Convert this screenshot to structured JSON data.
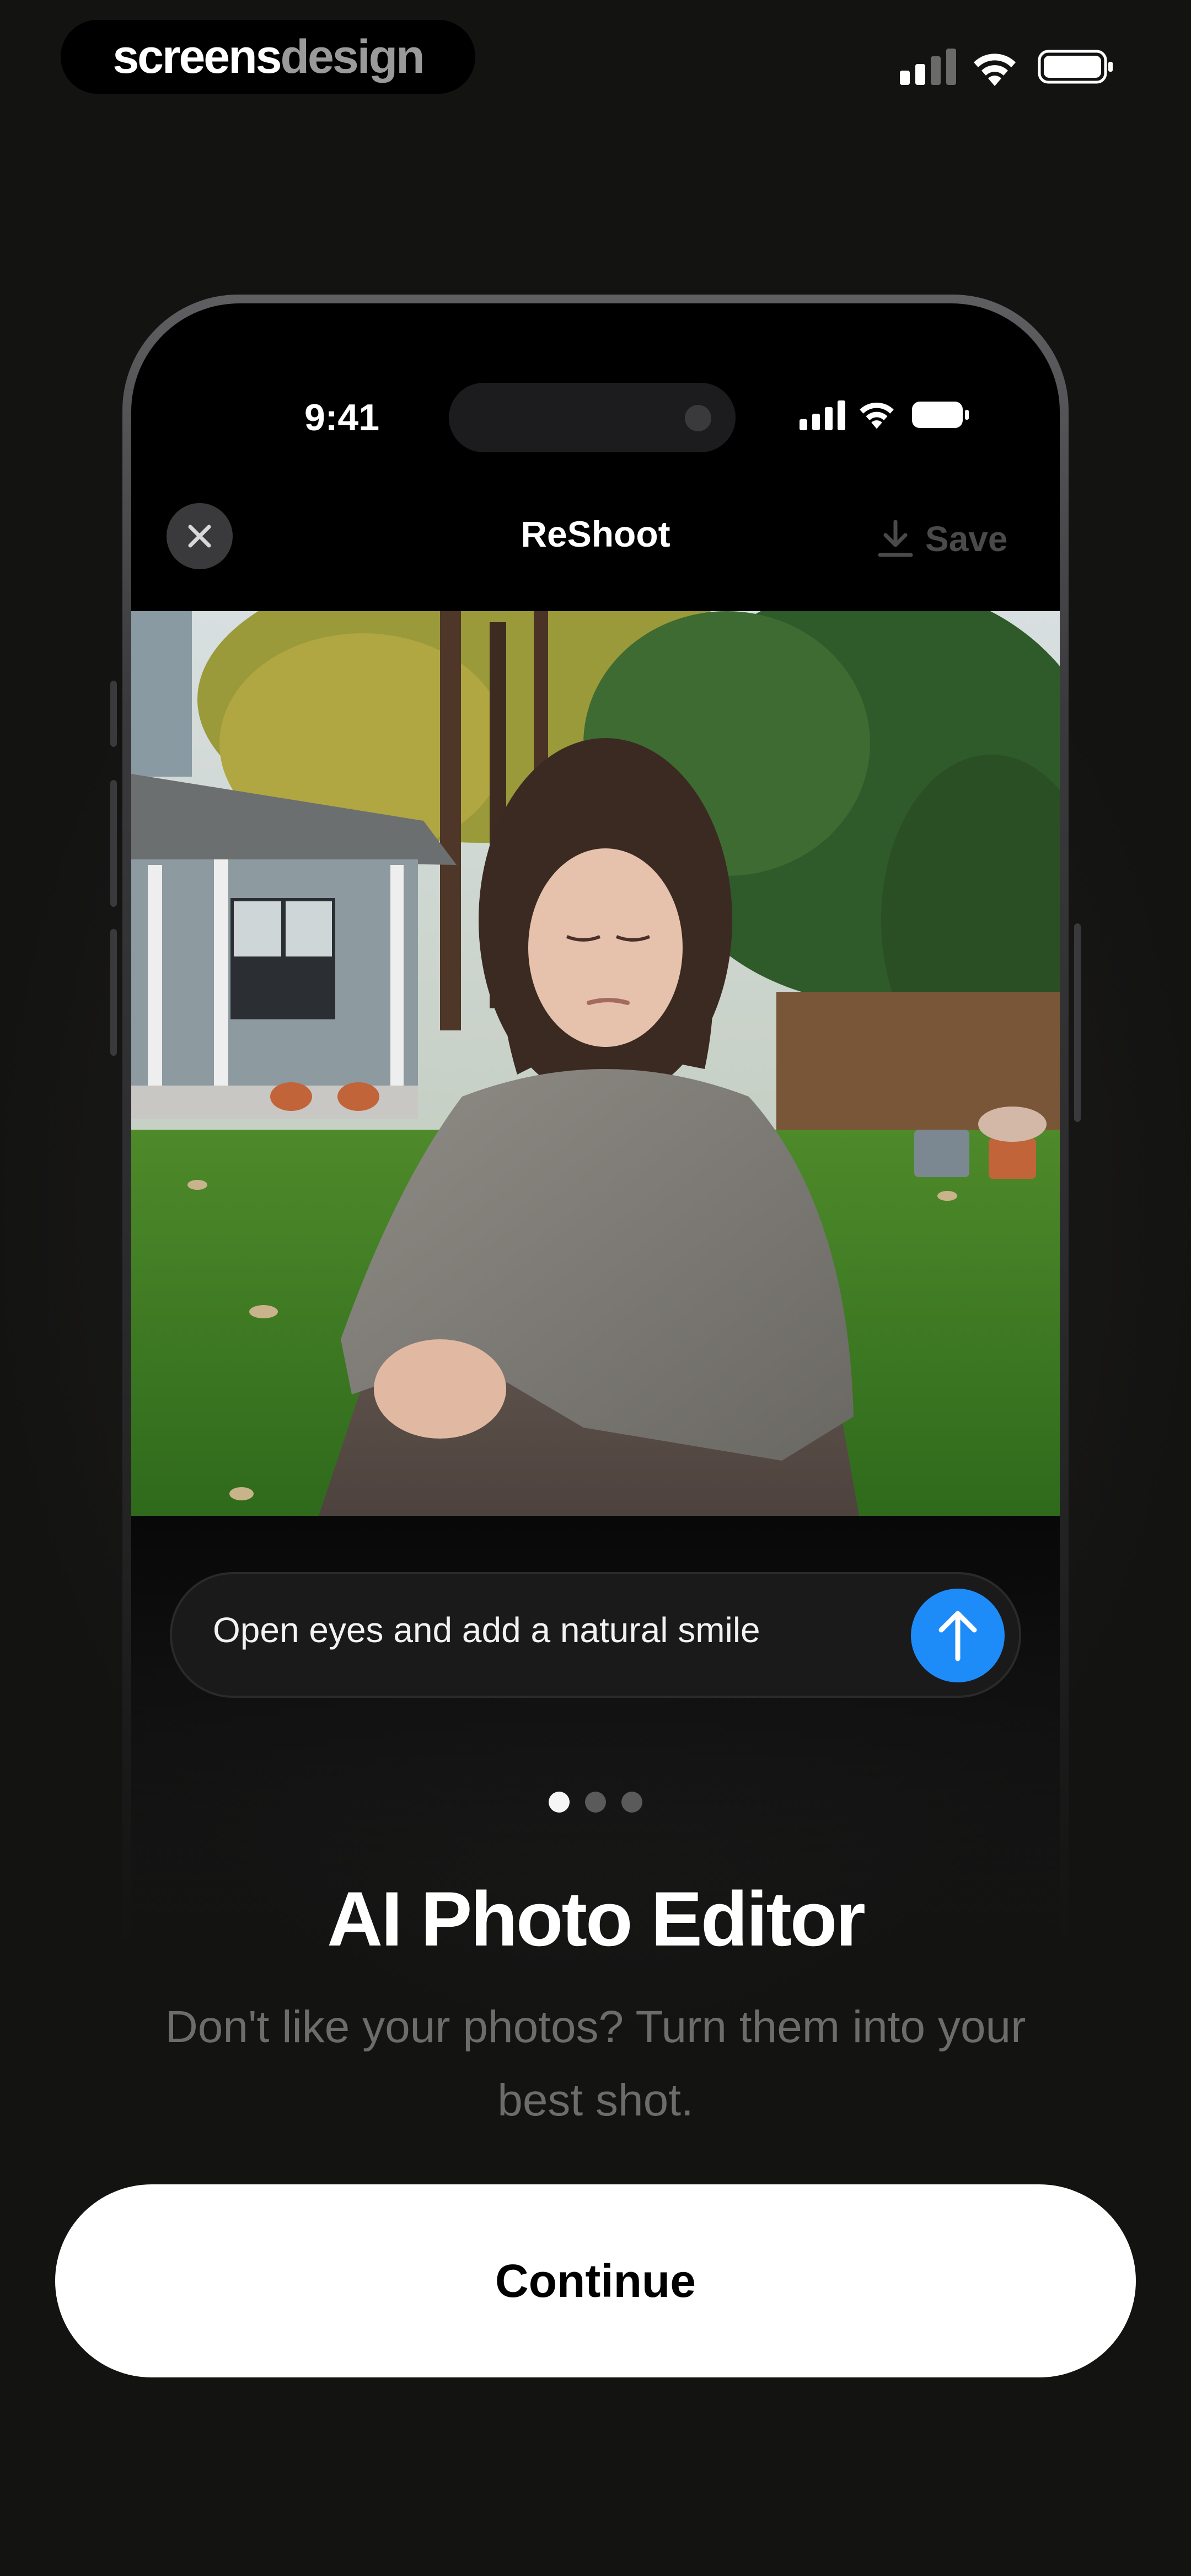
{
  "brand": {
    "part1": "screens",
    "part2": "design"
  },
  "phone": {
    "status_time": "9:41",
    "app_title": "ReShoot",
    "save_label": "Save",
    "prompt_text": "Open eyes and add a natural smile"
  },
  "pager": {
    "active_index": 0,
    "count": 3
  },
  "onboarding": {
    "title": "AI Photo Editor",
    "subtitle": "Don't like your photos? Turn them into your best shot.",
    "continue_label": "Continue"
  },
  "icons": {
    "close": "close-icon",
    "save": "download-icon",
    "send": "arrow-up-icon",
    "signal": "cellular-signal-icon",
    "wifi": "wifi-icon",
    "battery": "battery-icon"
  },
  "colors": {
    "accent": "#1e8cf8",
    "background": "#1b1a19",
    "button_bg": "#ffffff",
    "subtitle": "#6c6c6c"
  }
}
